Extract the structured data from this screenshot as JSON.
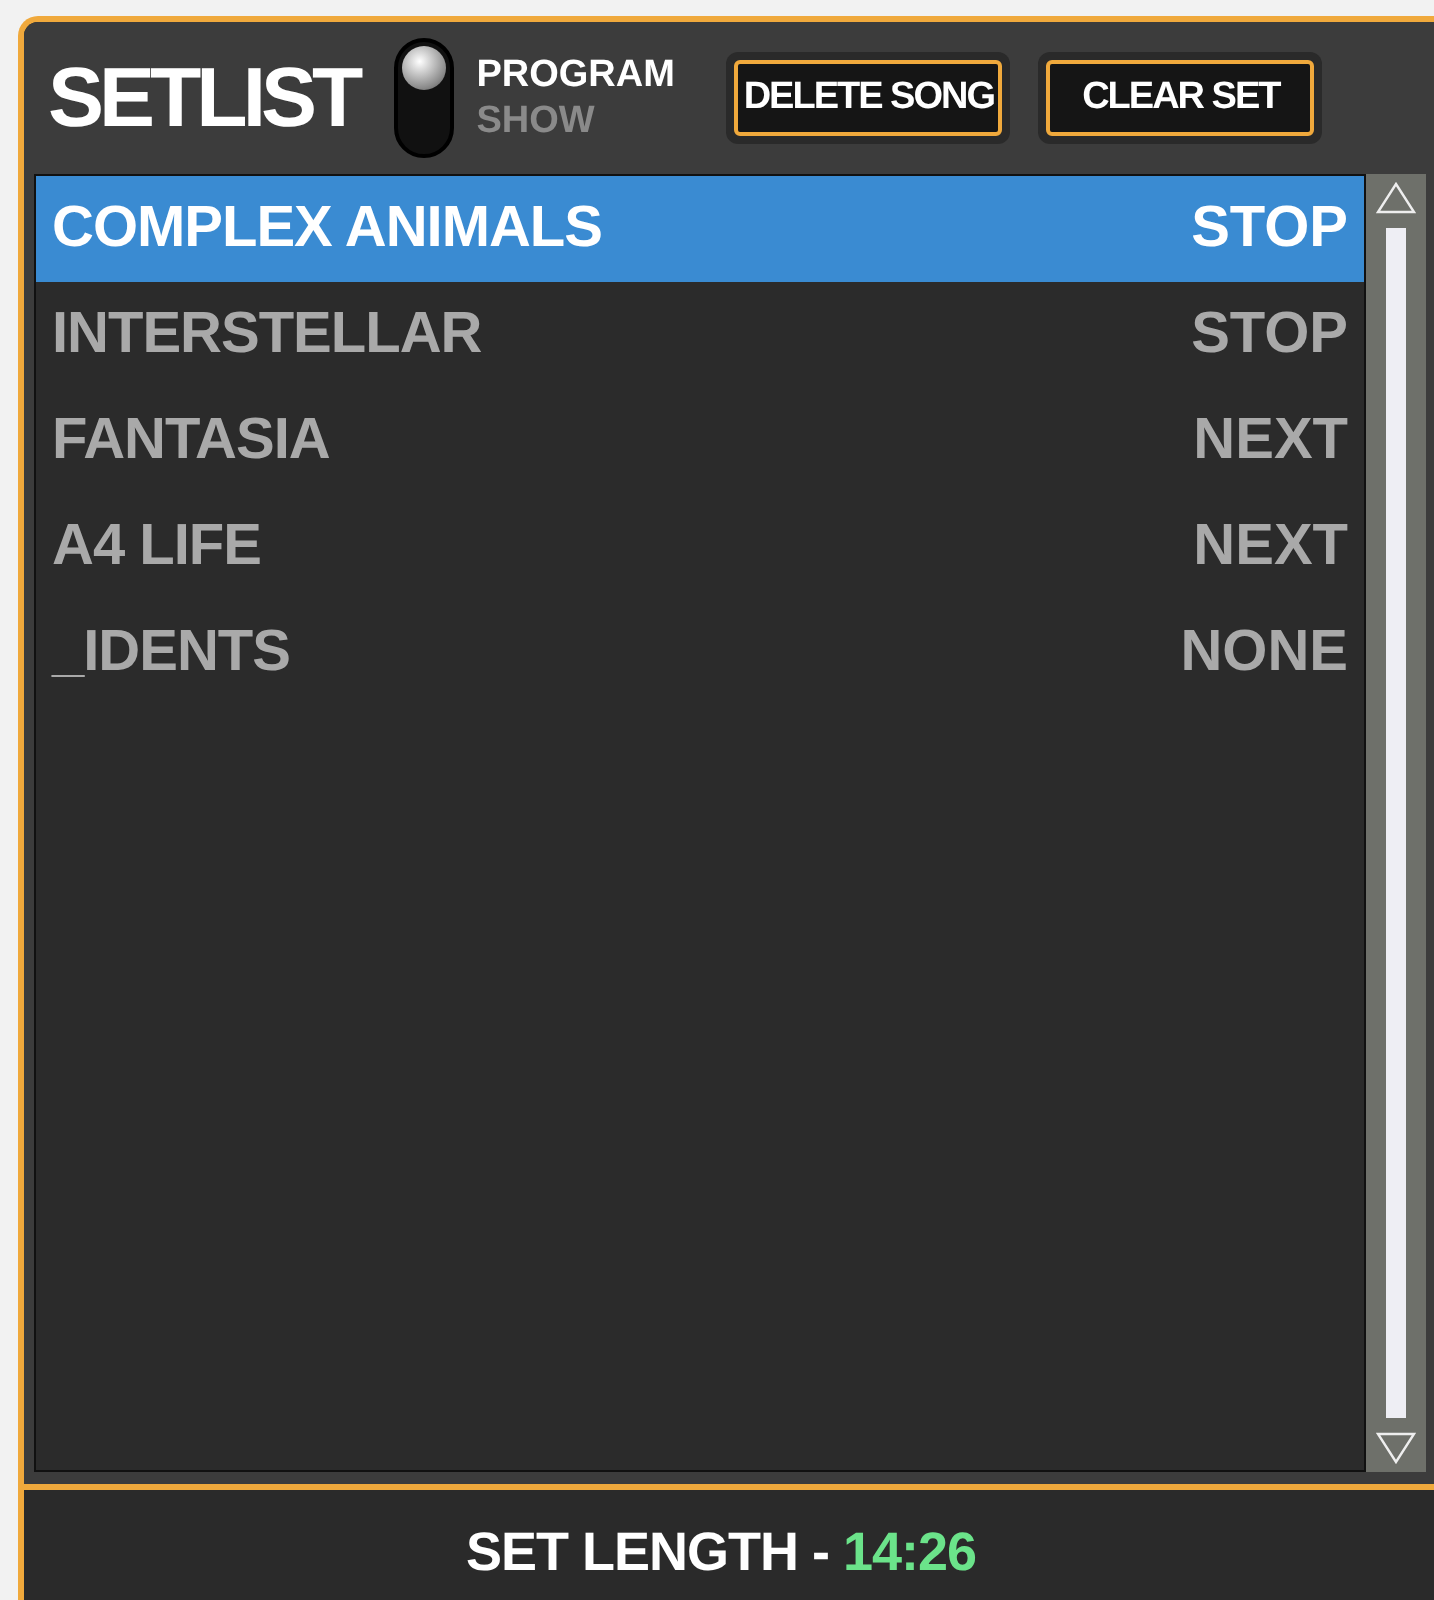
{
  "title": "SETLIST",
  "mode_switch": [
    {
      "label": "PROGRAM",
      "selected": true
    },
    {
      "label": "SHOW",
      "selected": false
    }
  ],
  "buttons": [
    "DELETE SONG",
    "CLEAR SET"
  ],
  "songs": [
    {
      "name": "COMPLEX ANIMALS",
      "action": "STOP",
      "selected": true
    },
    {
      "name": "INTERSTELLAR",
      "action": "STOP",
      "selected": false
    },
    {
      "name": "FANTASIA",
      "action": "NEXT",
      "selected": false
    },
    {
      "name": "A4 LIFE",
      "action": "NEXT",
      "selected": false
    },
    {
      "name": "_IDENTS",
      "action": "NONE",
      "selected": false
    }
  ],
  "footer": {
    "label": "SET LENGTH -",
    "value": "14:26"
  }
}
